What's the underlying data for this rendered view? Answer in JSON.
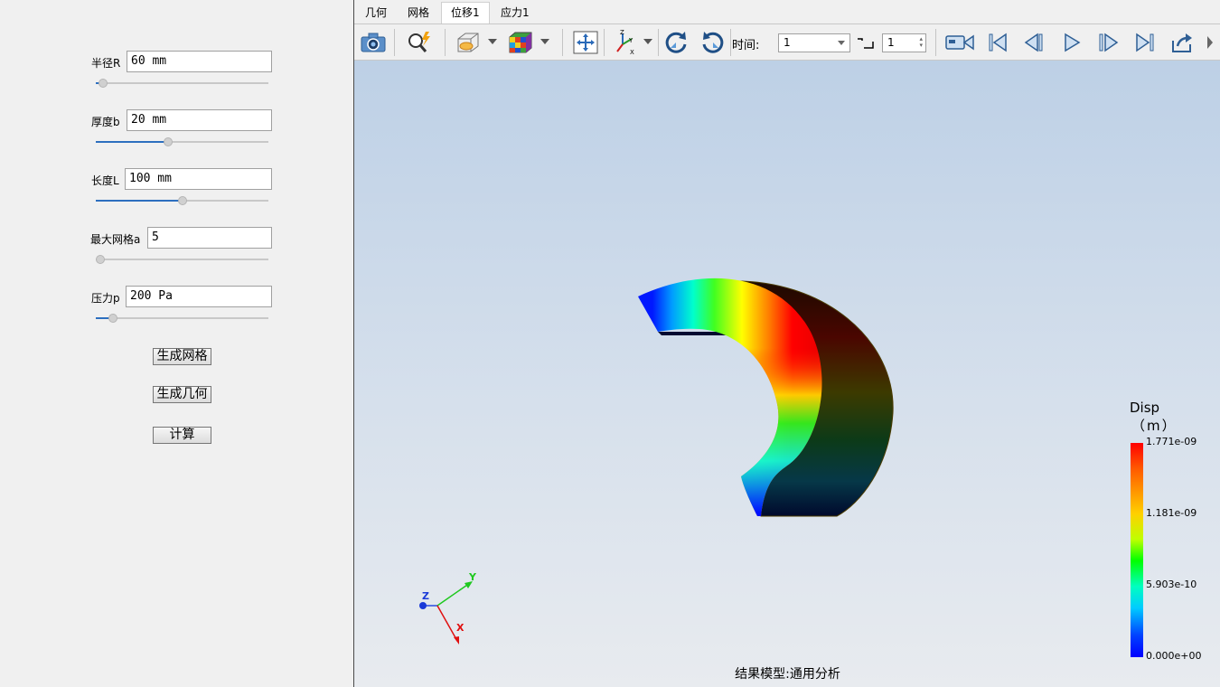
{
  "params": [
    {
      "label": "半径R",
      "value": "60 mm",
      "slider": 0.04
    },
    {
      "label": "厚度b",
      "value": "20 mm",
      "slider": 0.42
    },
    {
      "label": "长度L",
      "value": "100 mm",
      "slider": 0.5
    },
    {
      "label": "最大网格a",
      "value": "5",
      "slider": 0.0
    },
    {
      "label": "压力p",
      "value": "200 Pa",
      "slider": 0.1
    }
  ],
  "buttons": {
    "mesh": "生成网格",
    "geometry": "生成几何",
    "compute": "计算"
  },
  "tabs": [
    "几何",
    "网格",
    "位移1",
    "应力1"
  ],
  "active_tab": "位移1",
  "toolbar": {
    "time_label": "时间:",
    "time_value": "1",
    "step_value": "1"
  },
  "legend": {
    "title": "Disp",
    "unit": "（m）",
    "ticks": [
      "1.771e-09",
      "1.181e-09",
      "5.903e-10",
      "0.000e+00"
    ],
    "colors": {
      "max": "#ff0000",
      "min": "#0000ff"
    }
  },
  "axes": {
    "x": "X",
    "y": "Y",
    "z": "Z"
  },
  "footer": "结果模型:通用分析",
  "icons": [
    "camera-icon",
    "zoom-icon",
    "view-cube-icon",
    "color-cube-icon",
    "fit-view-icon",
    "axes-icon",
    "rotate-ccw-icon",
    "rotate-cw-icon",
    "record-icon",
    "first-frame-icon",
    "prev-frame-icon",
    "play-icon",
    "next-frame-icon",
    "last-frame-icon",
    "export-icon"
  ]
}
